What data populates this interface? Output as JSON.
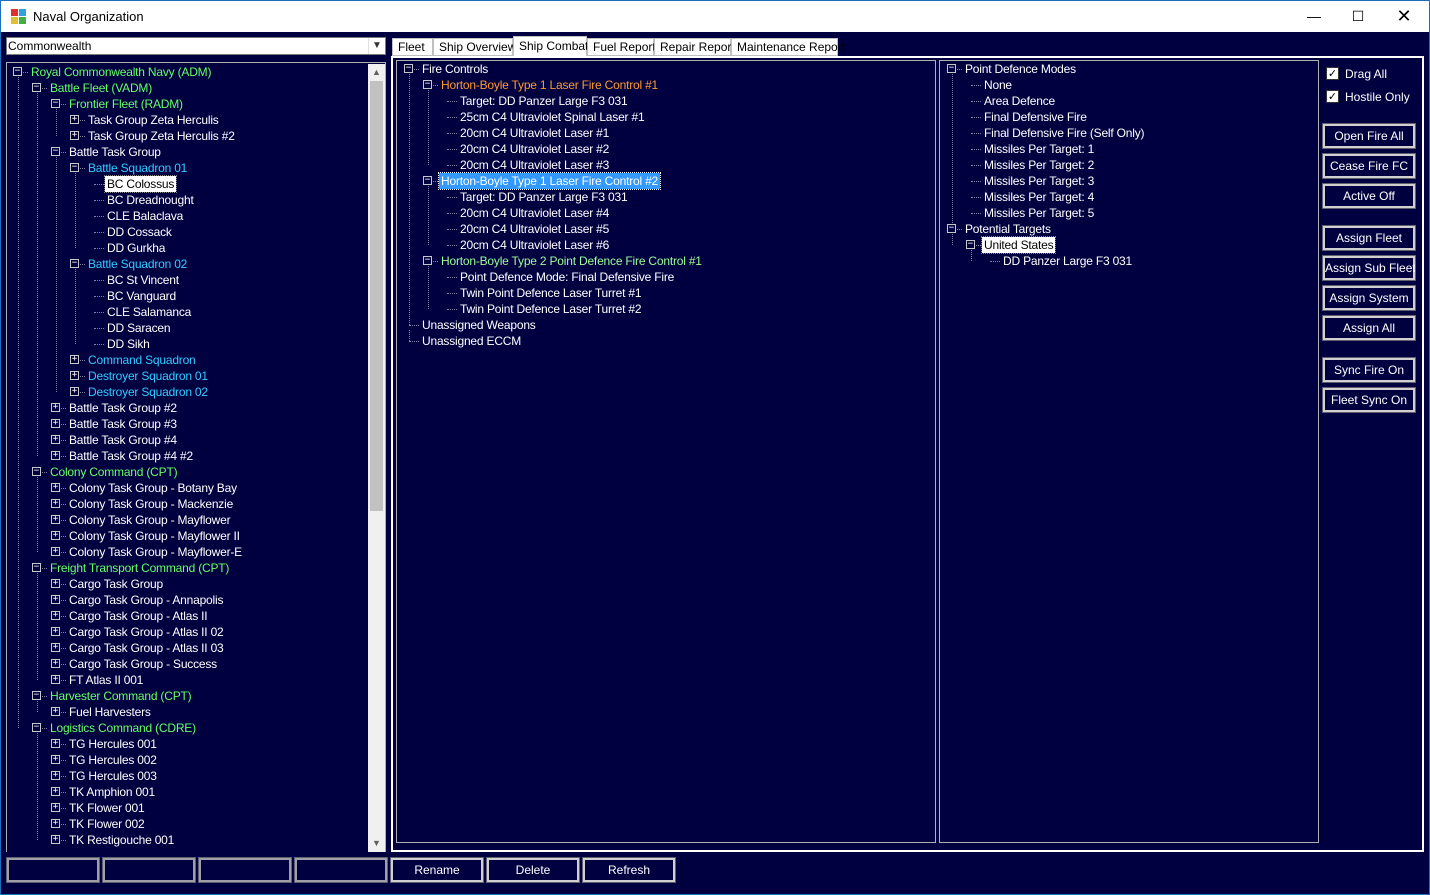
{
  "window": {
    "title": "Naval Organization"
  },
  "race_select": {
    "value": "Commonwealth"
  },
  "fleet_tree": [
    {
      "label": "Royal Commonwealth Navy  (ADM)",
      "level": 0,
      "exp": "minus",
      "color": "green"
    },
    {
      "label": "Battle Fleet  (VADM)",
      "level": 1,
      "exp": "minus",
      "color": "green"
    },
    {
      "label": "Frontier Fleet  (RADM)",
      "level": 2,
      "exp": "minus",
      "color": "green"
    },
    {
      "label": "Task Group Zeta Herculis",
      "level": 3,
      "exp": "plus",
      "color": "white"
    },
    {
      "label": "Task Group Zeta Herculis #2",
      "level": 3,
      "exp": "plus",
      "color": "white"
    },
    {
      "label": "Battle Task Group",
      "level": 2,
      "exp": "minus",
      "color": "white"
    },
    {
      "label": "Battle Squadron 01",
      "level": 3,
      "exp": "minus",
      "color": "cyan"
    },
    {
      "label": "BC Colossus",
      "level": 4,
      "exp": "",
      "color": "white",
      "selected": true
    },
    {
      "label": "BC Dreadnought",
      "level": 4,
      "exp": "",
      "color": "white"
    },
    {
      "label": "CLE Balaclava",
      "level": 4,
      "exp": "",
      "color": "white"
    },
    {
      "label": "DD Cossack",
      "level": 4,
      "exp": "",
      "color": "white"
    },
    {
      "label": "DD Gurkha",
      "level": 4,
      "exp": "",
      "color": "white"
    },
    {
      "label": "Battle Squadron 02",
      "level": 3,
      "exp": "minus",
      "color": "cyan"
    },
    {
      "label": "BC St Vincent",
      "level": 4,
      "exp": "",
      "color": "white"
    },
    {
      "label": "BC Vanguard",
      "level": 4,
      "exp": "",
      "color": "white"
    },
    {
      "label": "CLE Salamanca",
      "level": 4,
      "exp": "",
      "color": "white"
    },
    {
      "label": "DD Saracen",
      "level": 4,
      "exp": "",
      "color": "white"
    },
    {
      "label": "DD Sikh",
      "level": 4,
      "exp": "",
      "color": "white"
    },
    {
      "label": "Command Squadron",
      "level": 3,
      "exp": "plus",
      "color": "cyan"
    },
    {
      "label": "Destroyer Squadron 01",
      "level": 3,
      "exp": "plus",
      "color": "cyan"
    },
    {
      "label": "Destroyer Squadron 02",
      "level": 3,
      "exp": "plus",
      "color": "cyan"
    },
    {
      "label": "Battle Task Group #2",
      "level": 2,
      "exp": "plus",
      "color": "white"
    },
    {
      "label": "Battle Task Group #3",
      "level": 2,
      "exp": "plus",
      "color": "white"
    },
    {
      "label": "Battle Task Group #4",
      "level": 2,
      "exp": "plus",
      "color": "white"
    },
    {
      "label": "Battle Task Group #4 #2",
      "level": 2,
      "exp": "plus",
      "color": "white"
    },
    {
      "label": "Colony Command  (CPT)",
      "level": 1,
      "exp": "minus",
      "color": "green"
    },
    {
      "label": "Colony Task Group - Botany Bay",
      "level": 2,
      "exp": "plus",
      "color": "white"
    },
    {
      "label": "Colony Task Group - Mackenzie",
      "level": 2,
      "exp": "plus",
      "color": "white"
    },
    {
      "label": "Colony Task Group - Mayflower",
      "level": 2,
      "exp": "plus",
      "color": "white"
    },
    {
      "label": "Colony Task Group - Mayflower II",
      "level": 2,
      "exp": "plus",
      "color": "white"
    },
    {
      "label": "Colony Task Group - Mayflower-E",
      "level": 2,
      "exp": "plus",
      "color": "white"
    },
    {
      "label": "Freight Transport Command  (CPT)",
      "level": 1,
      "exp": "minus",
      "color": "green"
    },
    {
      "label": "Cargo Task Group",
      "level": 2,
      "exp": "plus",
      "color": "white"
    },
    {
      "label": "Cargo Task Group - Annapolis",
      "level": 2,
      "exp": "plus",
      "color": "white"
    },
    {
      "label": "Cargo Task Group - Atlas II",
      "level": 2,
      "exp": "plus",
      "color": "white"
    },
    {
      "label": "Cargo Task Group - Atlas II 02",
      "level": 2,
      "exp": "plus",
      "color": "white"
    },
    {
      "label": "Cargo Task Group - Atlas II 03",
      "level": 2,
      "exp": "plus",
      "color": "white"
    },
    {
      "label": "Cargo Task Group - Success",
      "level": 2,
      "exp": "plus",
      "color": "white"
    },
    {
      "label": "FT Atlas II 001",
      "level": 2,
      "exp": "plus",
      "color": "white"
    },
    {
      "label": "Harvester Command  (CPT)",
      "level": 1,
      "exp": "minus",
      "color": "green"
    },
    {
      "label": "Fuel Harvesters",
      "level": 2,
      "exp": "plus",
      "color": "white"
    },
    {
      "label": "Logistics Command  (CDRE)",
      "level": 1,
      "exp": "minus",
      "color": "green"
    },
    {
      "label": "TG Hercules 001",
      "level": 2,
      "exp": "plus",
      "color": "white"
    },
    {
      "label": "TG Hercules 002",
      "level": 2,
      "exp": "plus",
      "color": "white"
    },
    {
      "label": "TG Hercules 003",
      "level": 2,
      "exp": "plus",
      "color": "white"
    },
    {
      "label": "TK Amphion 001",
      "level": 2,
      "exp": "plus",
      "color": "white"
    },
    {
      "label": "TK Flower 001",
      "level": 2,
      "exp": "plus",
      "color": "white"
    },
    {
      "label": "TK Flower 002",
      "level": 2,
      "exp": "plus",
      "color": "white"
    },
    {
      "label": "TK Restigouche 001",
      "level": 2,
      "exp": "plus",
      "color": "white"
    }
  ],
  "tabs": [
    {
      "label": "Fleet",
      "active": false
    },
    {
      "label": "Ship Overview",
      "active": false
    },
    {
      "label": "Ship Combat",
      "active": true
    },
    {
      "label": "Fuel Report",
      "active": false
    },
    {
      "label": "Repair Report",
      "active": false
    },
    {
      "label": "Maintenance Report",
      "active": false
    }
  ],
  "fire_controls_tree": [
    {
      "label": "Fire Controls",
      "level": 0,
      "exp": "minus",
      "color": "white"
    },
    {
      "label": "Horton-Boyle Type 1 Laser Fire Control #1",
      "level": 1,
      "exp": "minus",
      "color": "orange"
    },
    {
      "label": "Target:  DD Panzer Large F3 031",
      "level": 2,
      "exp": "",
      "color": "white"
    },
    {
      "label": "25cm C4 Ultraviolet Spinal Laser #1",
      "level": 2,
      "exp": "",
      "color": "white"
    },
    {
      "label": "20cm C4 Ultraviolet Laser #1",
      "level": 2,
      "exp": "",
      "color": "white"
    },
    {
      "label": "20cm C4 Ultraviolet Laser #2",
      "level": 2,
      "exp": "",
      "color": "white"
    },
    {
      "label": "20cm C4 Ultraviolet Laser #3",
      "level": 2,
      "exp": "",
      "color": "white"
    },
    {
      "label": "Horton-Boyle Type 1 Laser Fire Control #2",
      "level": 1,
      "exp": "minus",
      "color": "white",
      "selected": true
    },
    {
      "label": "Target:  DD Panzer Large F3 031",
      "level": 2,
      "exp": "",
      "color": "white"
    },
    {
      "label": "20cm C4 Ultraviolet Laser #4",
      "level": 2,
      "exp": "",
      "color": "white"
    },
    {
      "label": "20cm C4 Ultraviolet Laser #5",
      "level": 2,
      "exp": "",
      "color": "white"
    },
    {
      "label": "20cm C4 Ultraviolet Laser #6",
      "level": 2,
      "exp": "",
      "color": "white"
    },
    {
      "label": "Horton-Boyle Type 2 Point Defence Fire Control #1",
      "level": 1,
      "exp": "minus",
      "color": "lgreen"
    },
    {
      "label": "Point Defence Mode:  Final Defensive Fire",
      "level": 2,
      "exp": "",
      "color": "white"
    },
    {
      "label": "Twin Point Defence Laser Turret #1",
      "level": 2,
      "exp": "",
      "color": "white"
    },
    {
      "label": "Twin Point Defence Laser Turret #2",
      "level": 2,
      "exp": "",
      "color": "white"
    },
    {
      "label": "Unassigned Weapons",
      "level": 0,
      "exp": "",
      "color": "white"
    },
    {
      "label": "Unassigned ECCM",
      "level": 0,
      "exp": "",
      "color": "white"
    }
  ],
  "pd_tree": [
    {
      "label": "Point Defence Modes",
      "level": 0,
      "exp": "minus",
      "color": "white"
    },
    {
      "label": "None",
      "level": 1,
      "exp": "",
      "color": "white"
    },
    {
      "label": "Area Defence",
      "level": 1,
      "exp": "",
      "color": "white"
    },
    {
      "label": "Final Defensive Fire",
      "level": 1,
      "exp": "",
      "color": "white"
    },
    {
      "label": "Final Defensive Fire (Self Only)",
      "level": 1,
      "exp": "",
      "color": "white"
    },
    {
      "label": "Missiles Per Target: 1",
      "level": 1,
      "exp": "",
      "color": "white"
    },
    {
      "label": "Missiles Per Target: 2",
      "level": 1,
      "exp": "",
      "color": "white"
    },
    {
      "label": "Missiles Per Target: 3",
      "level": 1,
      "exp": "",
      "color": "white"
    },
    {
      "label": "Missiles Per Target: 4",
      "level": 1,
      "exp": "",
      "color": "white"
    },
    {
      "label": "Missiles Per Target: 5",
      "level": 1,
      "exp": "",
      "color": "white"
    },
    {
      "label": "Potential Targets",
      "level": 0,
      "exp": "minus",
      "color": "white"
    },
    {
      "label": "United States",
      "level": 1,
      "exp": "minus",
      "color": "white",
      "selected": true
    },
    {
      "label": "DD Panzer Large F3 031",
      "level": 2,
      "exp": "",
      "color": "white"
    }
  ],
  "checkboxes": [
    {
      "label": "Drag All",
      "checked": true
    },
    {
      "label": "Hostile Only",
      "checked": true
    }
  ],
  "side_buttons": [
    {
      "label": "Open Fire All",
      "group": 0
    },
    {
      "label": "Cease Fire FC",
      "group": 0
    },
    {
      "label": "Active Off",
      "group": 0
    },
    {
      "label": "Assign Fleet",
      "group": 1
    },
    {
      "label": "Assign Sub Fleet",
      "group": 1
    },
    {
      "label": "Assign System",
      "group": 1
    },
    {
      "label": "Assign All",
      "group": 1
    },
    {
      "label": "Sync Fire On",
      "group": 2
    },
    {
      "label": "Fleet Sync On",
      "group": 2
    }
  ],
  "bottom_buttons": [
    {
      "label": "Rename"
    },
    {
      "label": "Delete"
    },
    {
      "label": "Refresh"
    }
  ]
}
